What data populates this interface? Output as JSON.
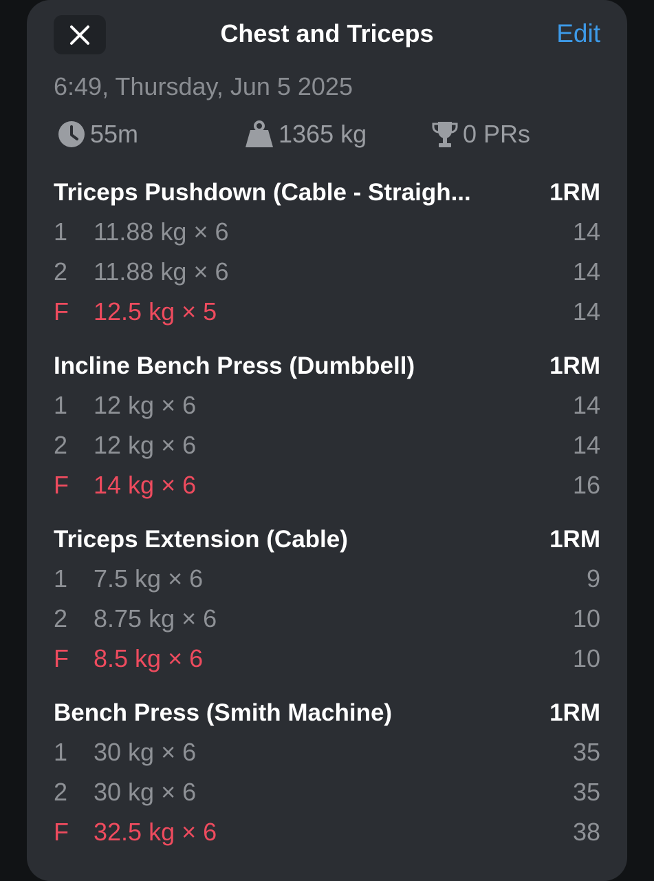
{
  "header": {
    "title": "Chest and Triceps",
    "edit_label": "Edit"
  },
  "workout": {
    "datetime": "6:49, Thursday, Jun 5 2025",
    "duration": "55m",
    "volume": "1365 kg",
    "prs": "0 PRs"
  },
  "exercises": [
    {
      "name": "Triceps Pushdown (Cable - Straigh...",
      "metric": "1RM",
      "sets": [
        {
          "index": "1",
          "value": "11.88 kg × 6",
          "one_rm": "14"
        },
        {
          "index": "2",
          "value": "11.88 kg × 6",
          "one_rm": "14"
        },
        {
          "index": "F",
          "value": "12.5 kg × 5",
          "one_rm": "14"
        }
      ]
    },
    {
      "name": "Incline Bench Press (Dumbbell)",
      "metric": "1RM",
      "sets": [
        {
          "index": "1",
          "value": "12 kg × 6",
          "one_rm": "14"
        },
        {
          "index": "2",
          "value": "12 kg × 6",
          "one_rm": "14"
        },
        {
          "index": "F",
          "value": "14 kg × 6",
          "one_rm": "16"
        }
      ]
    },
    {
      "name": "Triceps Extension (Cable)",
      "metric": "1RM",
      "sets": [
        {
          "index": "1",
          "value": "7.5 kg × 6",
          "one_rm": "9"
        },
        {
          "index": "2",
          "value": "8.75 kg × 6",
          "one_rm": "10"
        },
        {
          "index": "F",
          "value": "8.5 kg × 6",
          "one_rm": "10"
        }
      ]
    },
    {
      "name": "Bench Press (Smith Machine)",
      "metric": "1RM",
      "sets": [
        {
          "index": "1",
          "value": "30 kg × 6",
          "one_rm": "35"
        },
        {
          "index": "2",
          "value": "30 kg × 6",
          "one_rm": "35"
        },
        {
          "index": "F",
          "value": "32.5 kg × 6",
          "one_rm": "38"
        }
      ]
    }
  ],
  "icons": {
    "close": "close-icon",
    "duration": "clock-icon",
    "volume": "weight-icon",
    "prs": "trophy-icon"
  },
  "colors": {
    "accent": "#3d9ae8",
    "failure": "#ee4b5e",
    "background": "#2b2e33"
  }
}
